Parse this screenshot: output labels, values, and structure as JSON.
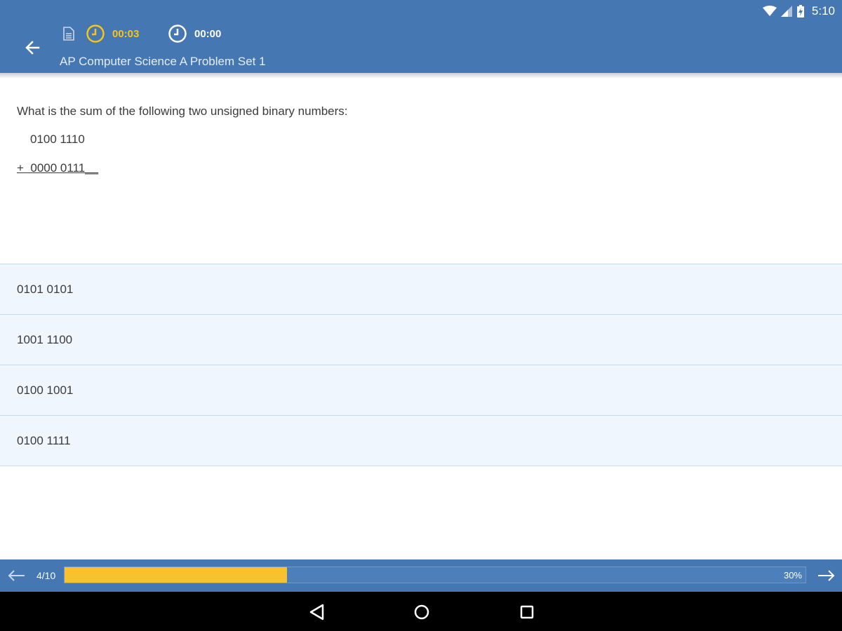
{
  "status_bar": {
    "time": "5:10",
    "icons": [
      "wifi-icon",
      "signal-icon",
      "battery-icon"
    ]
  },
  "header": {
    "title": "AP Computer Science A Problem Set 1",
    "question_timer": "00:03",
    "total_timer": "00:00",
    "icons": [
      "back-arrow-icon",
      "document-icon",
      "clock-icon"
    ]
  },
  "question": {
    "prompt": "What is the sum of the following two unsigned binary numbers:",
    "operand1": "0100 1110",
    "operand2": "+  0000 0111__"
  },
  "options": [
    {
      "label": "0101 0101"
    },
    {
      "label": "1001 1100"
    },
    {
      "label": "0100 1001"
    },
    {
      "label": "0100 1111"
    }
  ],
  "progress": {
    "counter": "4/10",
    "fraction": 0.3,
    "percent_label": "30%"
  },
  "colors": {
    "primary": "#4577b2",
    "accent": "#f8c22e",
    "option_bg": "#eff6fe"
  }
}
